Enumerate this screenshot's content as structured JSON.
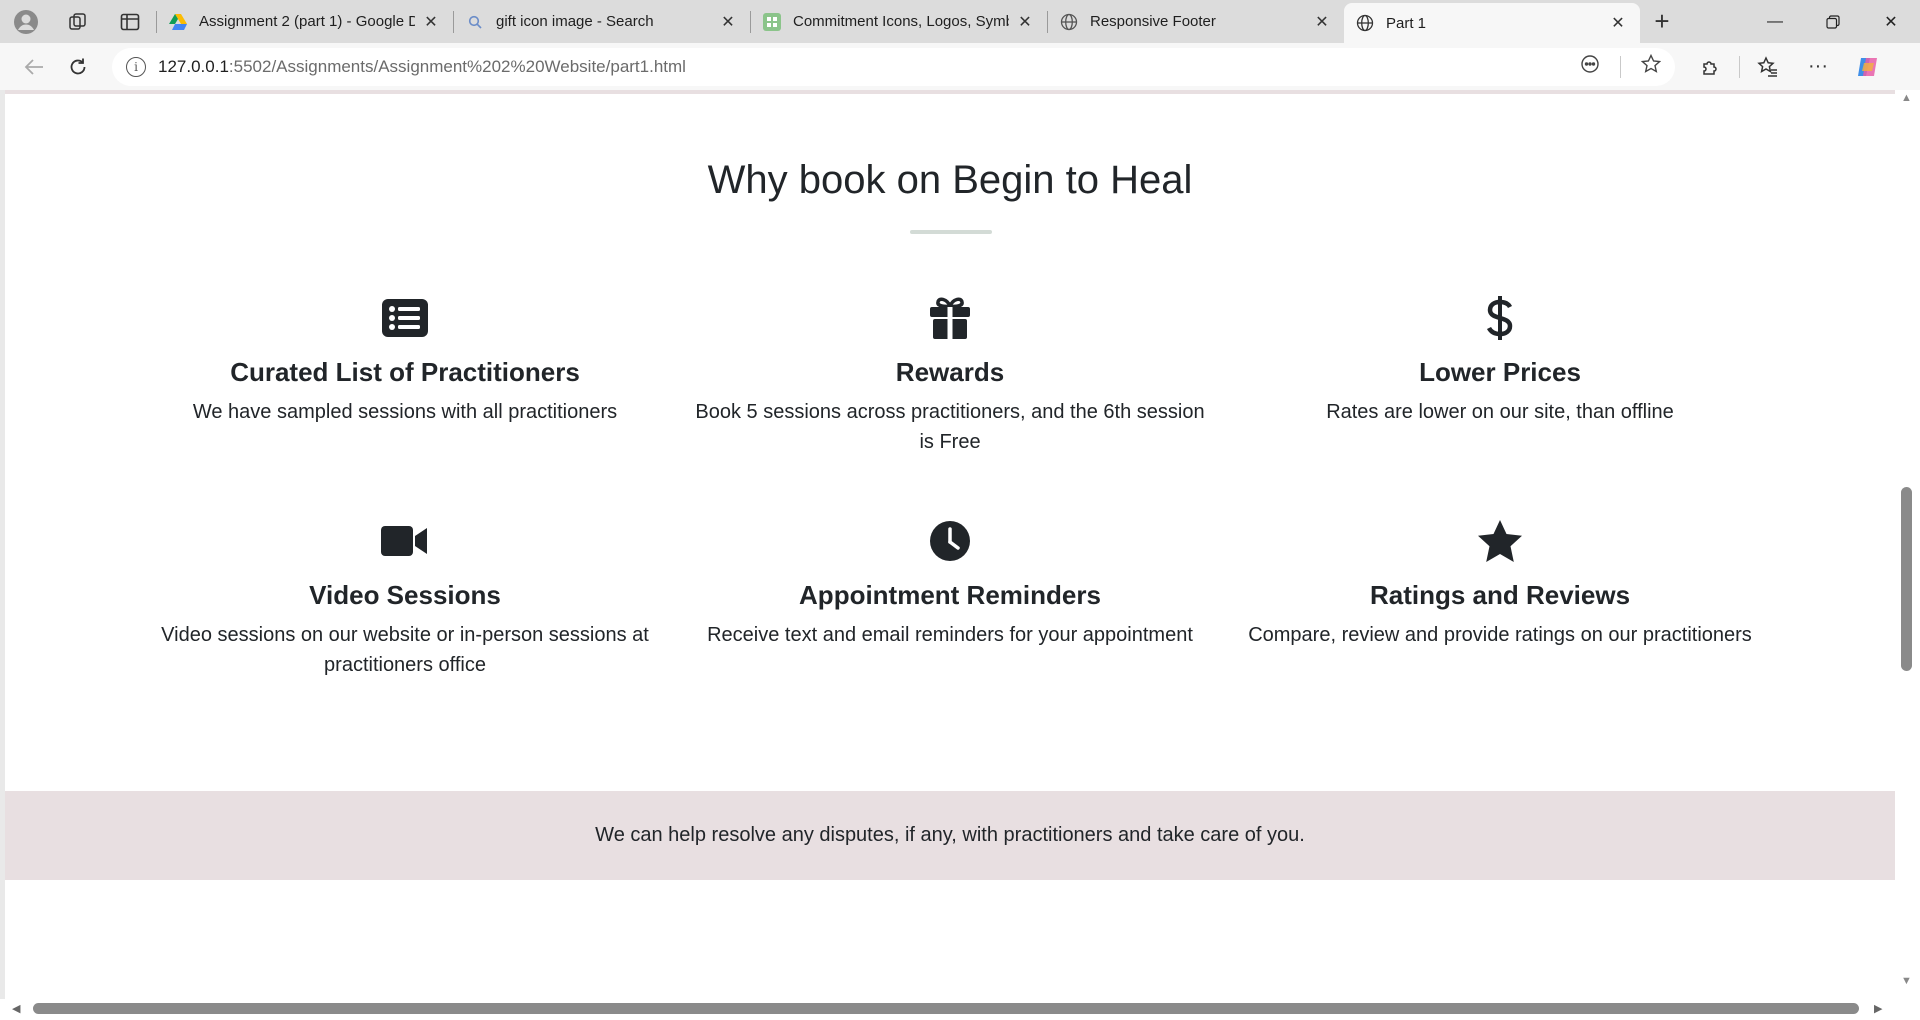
{
  "browser": {
    "tabs": [
      {
        "title": "Assignment 2 (part 1) - Google Dr",
        "favicon": "google-drive-icon"
      },
      {
        "title": "gift icon image - Search",
        "favicon": "search-icon"
      },
      {
        "title": "Commitment Icons, Logos, Symbo",
        "favicon": "sheet-icon"
      },
      {
        "title": "Responsive Footer",
        "favicon": "globe-icon"
      },
      {
        "title": "Part 1",
        "favicon": "globe-icon",
        "active": true
      }
    ],
    "url_host": "127.0.0.1",
    "url_path": ":5502/Assignments/Assignment%202%20Website/part1.html"
  },
  "page": {
    "section_title": "Why book on Begin to Heal",
    "features": [
      {
        "icon": "list-icon",
        "title": "Curated List of Practitioners",
        "text": "We have sampled sessions with all practitioners"
      },
      {
        "icon": "gift-icon",
        "title": "Rewards",
        "text": "Book 5 sessions across practitioners, and the 6th session is Free"
      },
      {
        "icon": "dollar-icon",
        "title": "Lower Prices",
        "text": "Rates are lower on our site, than offline"
      },
      {
        "icon": "video-camera-icon",
        "title": "Video Sessions",
        "text": "Video sessions on our website or in-person sessions at practitioners office"
      },
      {
        "icon": "clock-icon",
        "title": "Appointment Reminders",
        "text": "Receive text and email reminders for your appointment"
      },
      {
        "icon": "star-icon",
        "title": "Ratings and Reviews",
        "text": "Compare, review and provide ratings on our practitioners"
      }
    ],
    "banner_text": "We can help resolve any disputes, if any, with practitioners and take care of you."
  },
  "colors": {
    "banner_bg": "#e8dfe1",
    "underline": "#d3dbd6",
    "text": "#212529"
  }
}
